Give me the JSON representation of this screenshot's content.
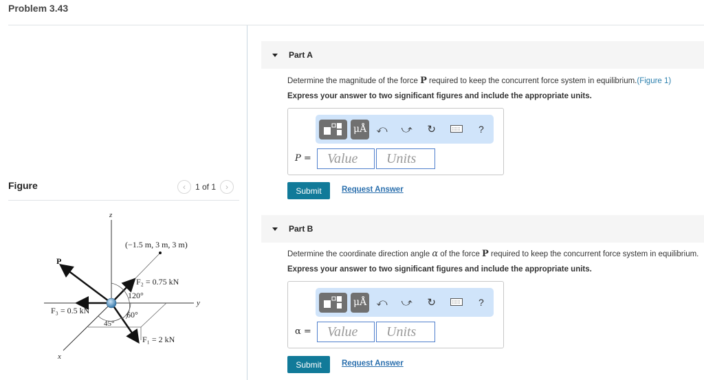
{
  "page": {
    "title": "Problem 3.43"
  },
  "figure_panel": {
    "heading": "Figure",
    "pager": {
      "prev_icon": "chevron-left-icon",
      "count": "1 of 1",
      "next_icon": "chevron-right-icon"
    },
    "diagram": {
      "axis_labels": {
        "z": "z",
        "y": "y",
        "x": "x"
      },
      "point_label": "(−1.5 m, 3 m, 3 m)",
      "force_P": "P",
      "force_F2": "F₂ = 0.75 kN",
      "force_F3": "F₃ = 0.5 kN",
      "force_F1": "F₁ = 2 kN",
      "angle_120": "120°",
      "angle_60": "60°",
      "angle_45": "45°"
    }
  },
  "parts": [
    {
      "label": "Part A",
      "question_before": "Determine the magnitude of the force ",
      "question_symbol": "P",
      "question_after": " required to keep the concurrent force system in equilibrium.",
      "figure_link": "(Figure 1)",
      "instruction": "Express your answer to two significant figures and include the appropriate units.",
      "toolbar": [
        "templates-icon",
        "units-icon",
        "undo-icon",
        "redo-icon",
        "reset-icon",
        "keyboard-icon",
        "help-icon"
      ],
      "units_glyph": "μÅ",
      "help_glyph": "?",
      "variable": "P =",
      "value_placeholder": "Value",
      "units_placeholder": "Units",
      "submit": "Submit",
      "request": "Request Answer"
    },
    {
      "label": "Part B",
      "question_before": "Determine the coordinate direction angle ",
      "question_symbol_alpha": "α",
      "question_middle": " of the force ",
      "question_symbol": "P",
      "question_after": " required to keep the concurrent force system in equilibrium.",
      "instruction": "Express your answer to two significant figures and include the appropriate units.",
      "toolbar": [
        "templates-icon",
        "units-icon",
        "undo-icon",
        "redo-icon",
        "reset-icon",
        "keyboard-icon",
        "help-icon"
      ],
      "units_glyph": "μÅ",
      "help_glyph": "?",
      "variable": "α =",
      "value_placeholder": "Value",
      "units_placeholder": "Units",
      "submit": "Submit",
      "request": "Request Answer"
    }
  ]
}
